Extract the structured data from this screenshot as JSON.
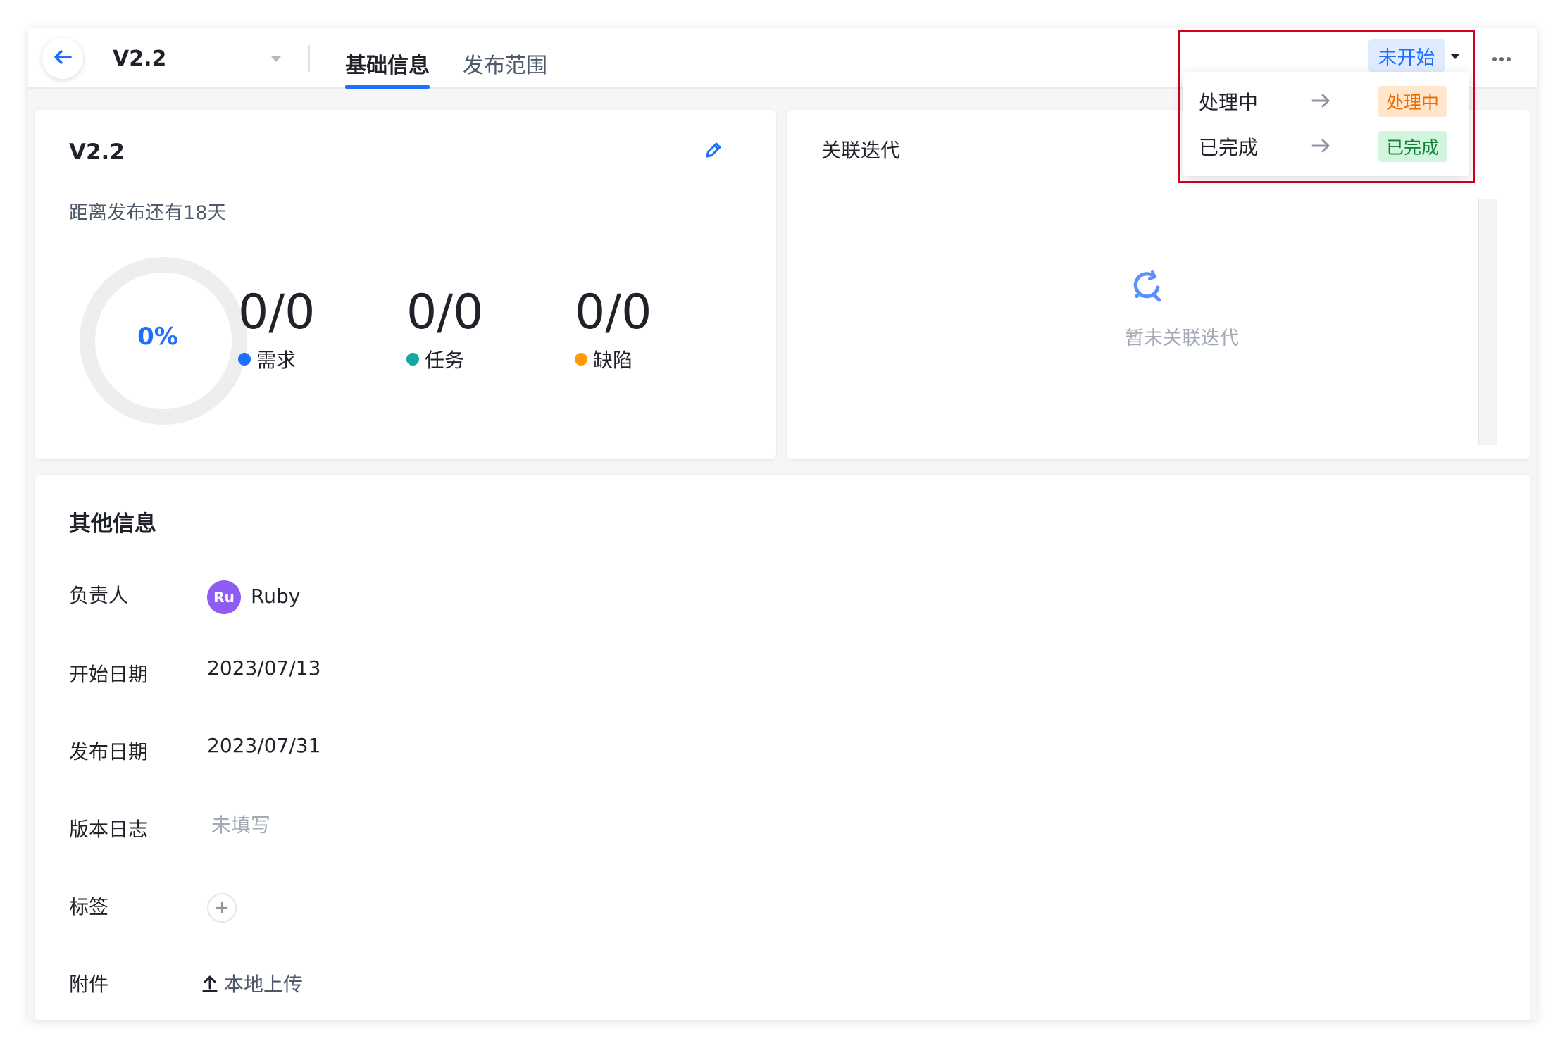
{
  "header": {
    "version": "V2.2",
    "tabs": [
      {
        "label": "基础信息",
        "active": true
      },
      {
        "label": "发布范围",
        "active": false
      }
    ],
    "status": "未开始"
  },
  "status_menu": [
    {
      "from": "处理中",
      "to": "处理中",
      "color": "#ef6c00"
    },
    {
      "from": "已完成",
      "to": "已完成",
      "color": "#15803d"
    }
  ],
  "version_card": {
    "title": "V2.2",
    "countdown": "距离发布还有18天",
    "progress_percent": "0%",
    "progress_value": 0,
    "stats": [
      {
        "value": "0/0",
        "label": "需求",
        "color": "#1e6fff"
      },
      {
        "value": "0/0",
        "label": "任务",
        "color": "#14a8a0"
      },
      {
        "value": "0/0",
        "label": "缺陷",
        "color": "#ff9a0a"
      }
    ]
  },
  "iteration_card": {
    "title": "关联迭代",
    "empty_text": "暂未关联迭代"
  },
  "other_info": {
    "title": "其他信息",
    "owner_label": "负责人",
    "owner_initials": "Ru",
    "owner_name": "Ruby",
    "start_label": "开始日期",
    "start_date": "2023/07/13",
    "release_label": "发布日期",
    "release_date": "2023/07/31",
    "changelog_label": "版本日志",
    "changelog_placeholder": "未填写",
    "tags_label": "标签",
    "attachment_label": "附件",
    "upload_label": "本地上传"
  },
  "colors": {
    "accent": "#1e6fff",
    "highlight": "#d0021b"
  }
}
